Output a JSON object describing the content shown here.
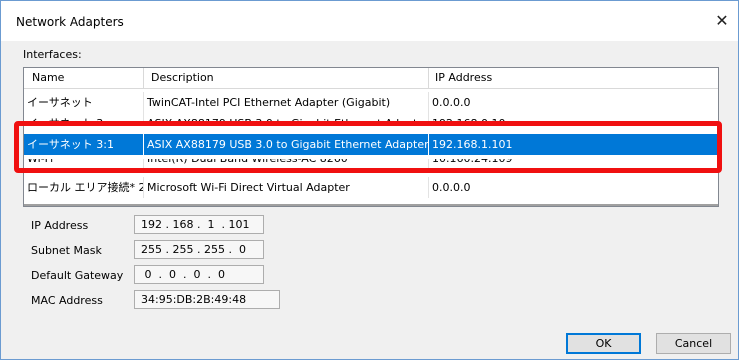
{
  "window": {
    "title": "Network Adapters",
    "close_glyph": "✕"
  },
  "interfaces": {
    "label": "Interfaces:",
    "columns": [
      "Name",
      "Description",
      "IP Address"
    ],
    "rows": [
      {
        "name": "イーサネット",
        "description": "TwinCAT-Intel PCI Ethernet Adapter (Gigabit)",
        "ip": "0.0.0.0"
      },
      {
        "name": "イーサネット 3",
        "description": "ASIX AX88179 USB 3.0 to Gigabit Ethernet Adapter",
        "ip": "192.168.0.10"
      },
      {
        "name": "イーサネット 3:1",
        "description": "ASIX AX88179 USB 3.0 to Gigabit Ethernet Adapter",
        "ip": "192.168.1.101"
      },
      {
        "name": "Wi-Fi",
        "description": "Intel(R) Dual Band Wireless-AC 8260",
        "ip": "10.160.24.109"
      },
      {
        "name": "ローカル エリア接続* 2",
        "description": "Microsoft Wi-Fi Direct Virtual Adapter",
        "ip": "0.0.0.0"
      }
    ],
    "selected_index": 2
  },
  "details": {
    "ip_address": {
      "label": "IP Address",
      "value": "192 . 168 .  1  . 101"
    },
    "subnet_mask": {
      "label": "Subnet Mask",
      "value": "255 . 255 . 255 .  0"
    },
    "default_gateway": {
      "label": "Default Gateway",
      "value": " 0  .  0  .  0  .  0"
    },
    "mac_address": {
      "label": "MAC Address",
      "value": "34:95:DB:2B:49:48"
    }
  },
  "buttons": {
    "ok": "OK",
    "cancel": "Cancel"
  },
  "colors": {
    "selection": "#0078d7",
    "highlight_box": "#f01010"
  }
}
